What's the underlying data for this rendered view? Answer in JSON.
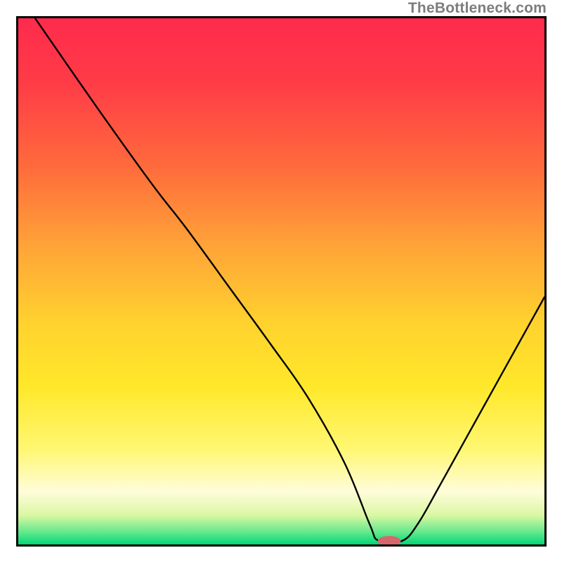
{
  "watermark": "TheBottleneck.com",
  "chart_data": {
    "type": "line",
    "title": "",
    "xlabel": "",
    "ylabel": "",
    "xlim": [
      0,
      100
    ],
    "ylim": [
      0,
      100
    ],
    "grid": false,
    "series": [
      {
        "name": "curve",
        "x": [
          3.2,
          15,
          25.4,
          32,
          40,
          48,
          55,
          62,
          66.8,
          68.5,
          73,
          76,
          80,
          85,
          90,
          95,
          100
        ],
        "values": [
          100,
          83,
          68.5,
          60,
          49,
          38,
          28,
          15.5,
          3.8,
          0.7,
          0.7,
          4.0,
          11,
          20,
          29,
          38,
          47
        ]
      }
    ],
    "marker": {
      "x_center": 70.5,
      "y_center": 0.65,
      "rx": 2.2,
      "ry": 0.95,
      "color": "#d6666c"
    },
    "gradient_stops": [
      {
        "offset": 0.0,
        "color": "#ff2b4c"
      },
      {
        "offset": 0.12,
        "color": "#ff3b47"
      },
      {
        "offset": 0.28,
        "color": "#ff6a3c"
      },
      {
        "offset": 0.44,
        "color": "#ffa637"
      },
      {
        "offset": 0.58,
        "color": "#ffd22e"
      },
      {
        "offset": 0.7,
        "color": "#ffe82a"
      },
      {
        "offset": 0.82,
        "color": "#fff773"
      },
      {
        "offset": 0.9,
        "color": "#fffdda"
      },
      {
        "offset": 0.945,
        "color": "#d9f7a2"
      },
      {
        "offset": 0.975,
        "color": "#6ae98e"
      },
      {
        "offset": 1.0,
        "color": "#00d877"
      }
    ]
  }
}
